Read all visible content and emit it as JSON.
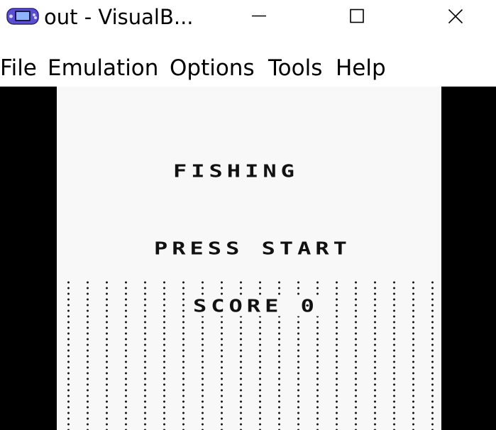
{
  "window": {
    "title": "out - VisualB...",
    "app_icon": "gameboy-advance-icon",
    "controls": {
      "minimize_icon": "minimize-icon",
      "maximize_icon": "maximize-icon",
      "close_icon": "close-icon"
    }
  },
  "menubar": {
    "items": [
      {
        "label": "File"
      },
      {
        "label": "Emulation"
      },
      {
        "label": "Options"
      },
      {
        "label": "Tools"
      },
      {
        "label": "Help"
      }
    ]
  },
  "game": {
    "title": "FISHING",
    "prompt": "PRESS START",
    "score_label": "SCORE",
    "score_value": "0"
  },
  "colors": {
    "screen_bg": "#f8f8f8",
    "pixel_dark": "#111111",
    "letterbox": "#000000"
  }
}
